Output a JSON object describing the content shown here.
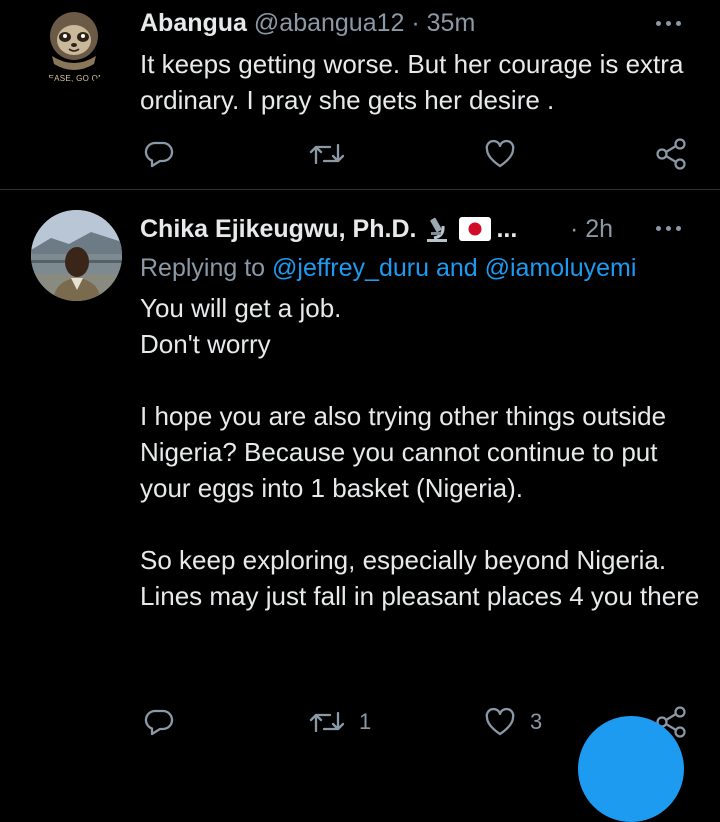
{
  "tweet1": {
    "name": "Abangua",
    "handle": "@abangua12",
    "separator": "·",
    "time": "35m",
    "avatar_text": "LEASE, GO ON",
    "text": "It keeps getting worse. But her courage is extra ordinary. I pray she gets her desire ."
  },
  "tweet2": {
    "name": "Chika Ejikeugwu, Ph.D.",
    "name_suffix": "...",
    "separator": "·",
    "time": "2h",
    "replying_prefix": "Replying to",
    "reply_user1": "@jeffrey_duru",
    "reply_and": "and",
    "reply_user2": "@iamoluyemi",
    "text": "You will get a job.\nDon't worry\n\nI hope you are also trying other things outside Nigeria? Because you cannot continue to put your eggs into 1 basket (Nigeria).\n\nSo keep exploring, especially beyond Nigeria. Lines may just fall in pleasant places 4 you there",
    "retweet_count": "1",
    "like_count": "3"
  },
  "icons": {
    "reply": "reply-icon",
    "retweet": "retweet-icon",
    "like": "heart-icon",
    "share": "share-icon",
    "more": "more-dots-icon",
    "microscope": "microscope-icon",
    "flag": "japan-flag-icon",
    "compose": "compose-fab"
  },
  "colors": {
    "background": "#000000",
    "text": "#e7e9ea",
    "muted": "#8b98a5",
    "link": "#1d9bf0",
    "divider": "#2f3336"
  }
}
